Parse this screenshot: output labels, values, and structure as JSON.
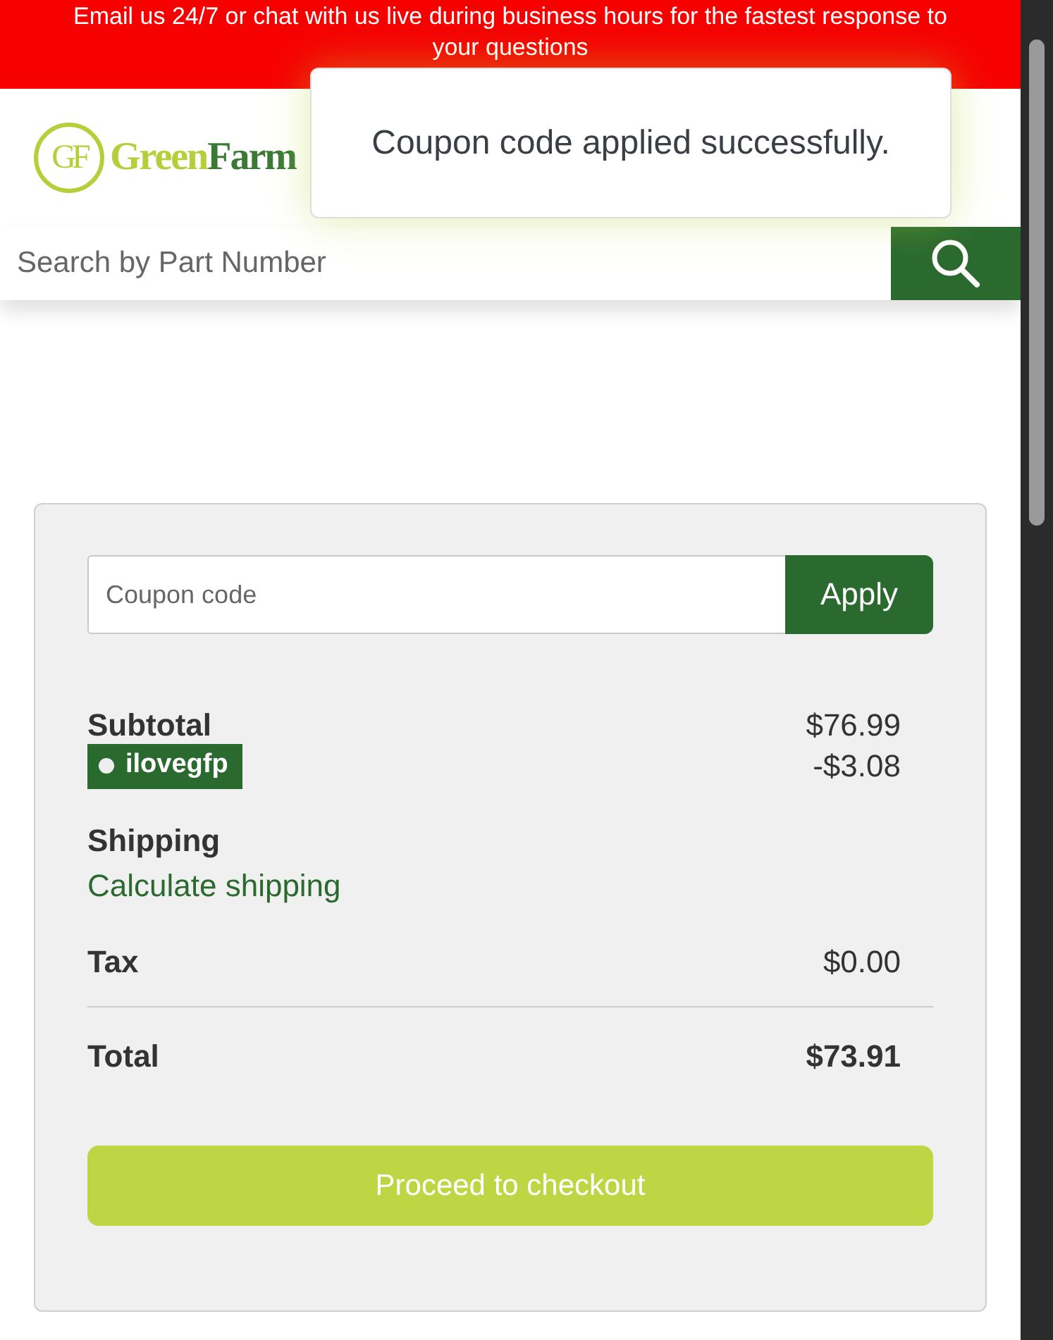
{
  "banner": {
    "text": "Email us 24/7 or chat with us live during business hours for the fastest response to your questions"
  },
  "logo": {
    "monogram": "GF",
    "name_light": "Green",
    "name_dark": "Farm"
  },
  "toast": {
    "message": "Coupon code applied successfully."
  },
  "search": {
    "placeholder": "Search by Part Number"
  },
  "cart_summary": {
    "coupon_field": {
      "placeholder": "Coupon code"
    },
    "apply_button": "Apply",
    "subtotal": {
      "label": "Subtotal",
      "value": "$76.99"
    },
    "coupon": {
      "code": "ilovegfp",
      "discount": "-$3.08"
    },
    "shipping": {
      "label": "Shipping",
      "link": "Calculate shipping"
    },
    "tax": {
      "label": "Tax",
      "value": "$0.00"
    },
    "total": {
      "label": "Total",
      "value": "$73.91"
    },
    "checkout_button": "Proceed to checkout"
  }
}
